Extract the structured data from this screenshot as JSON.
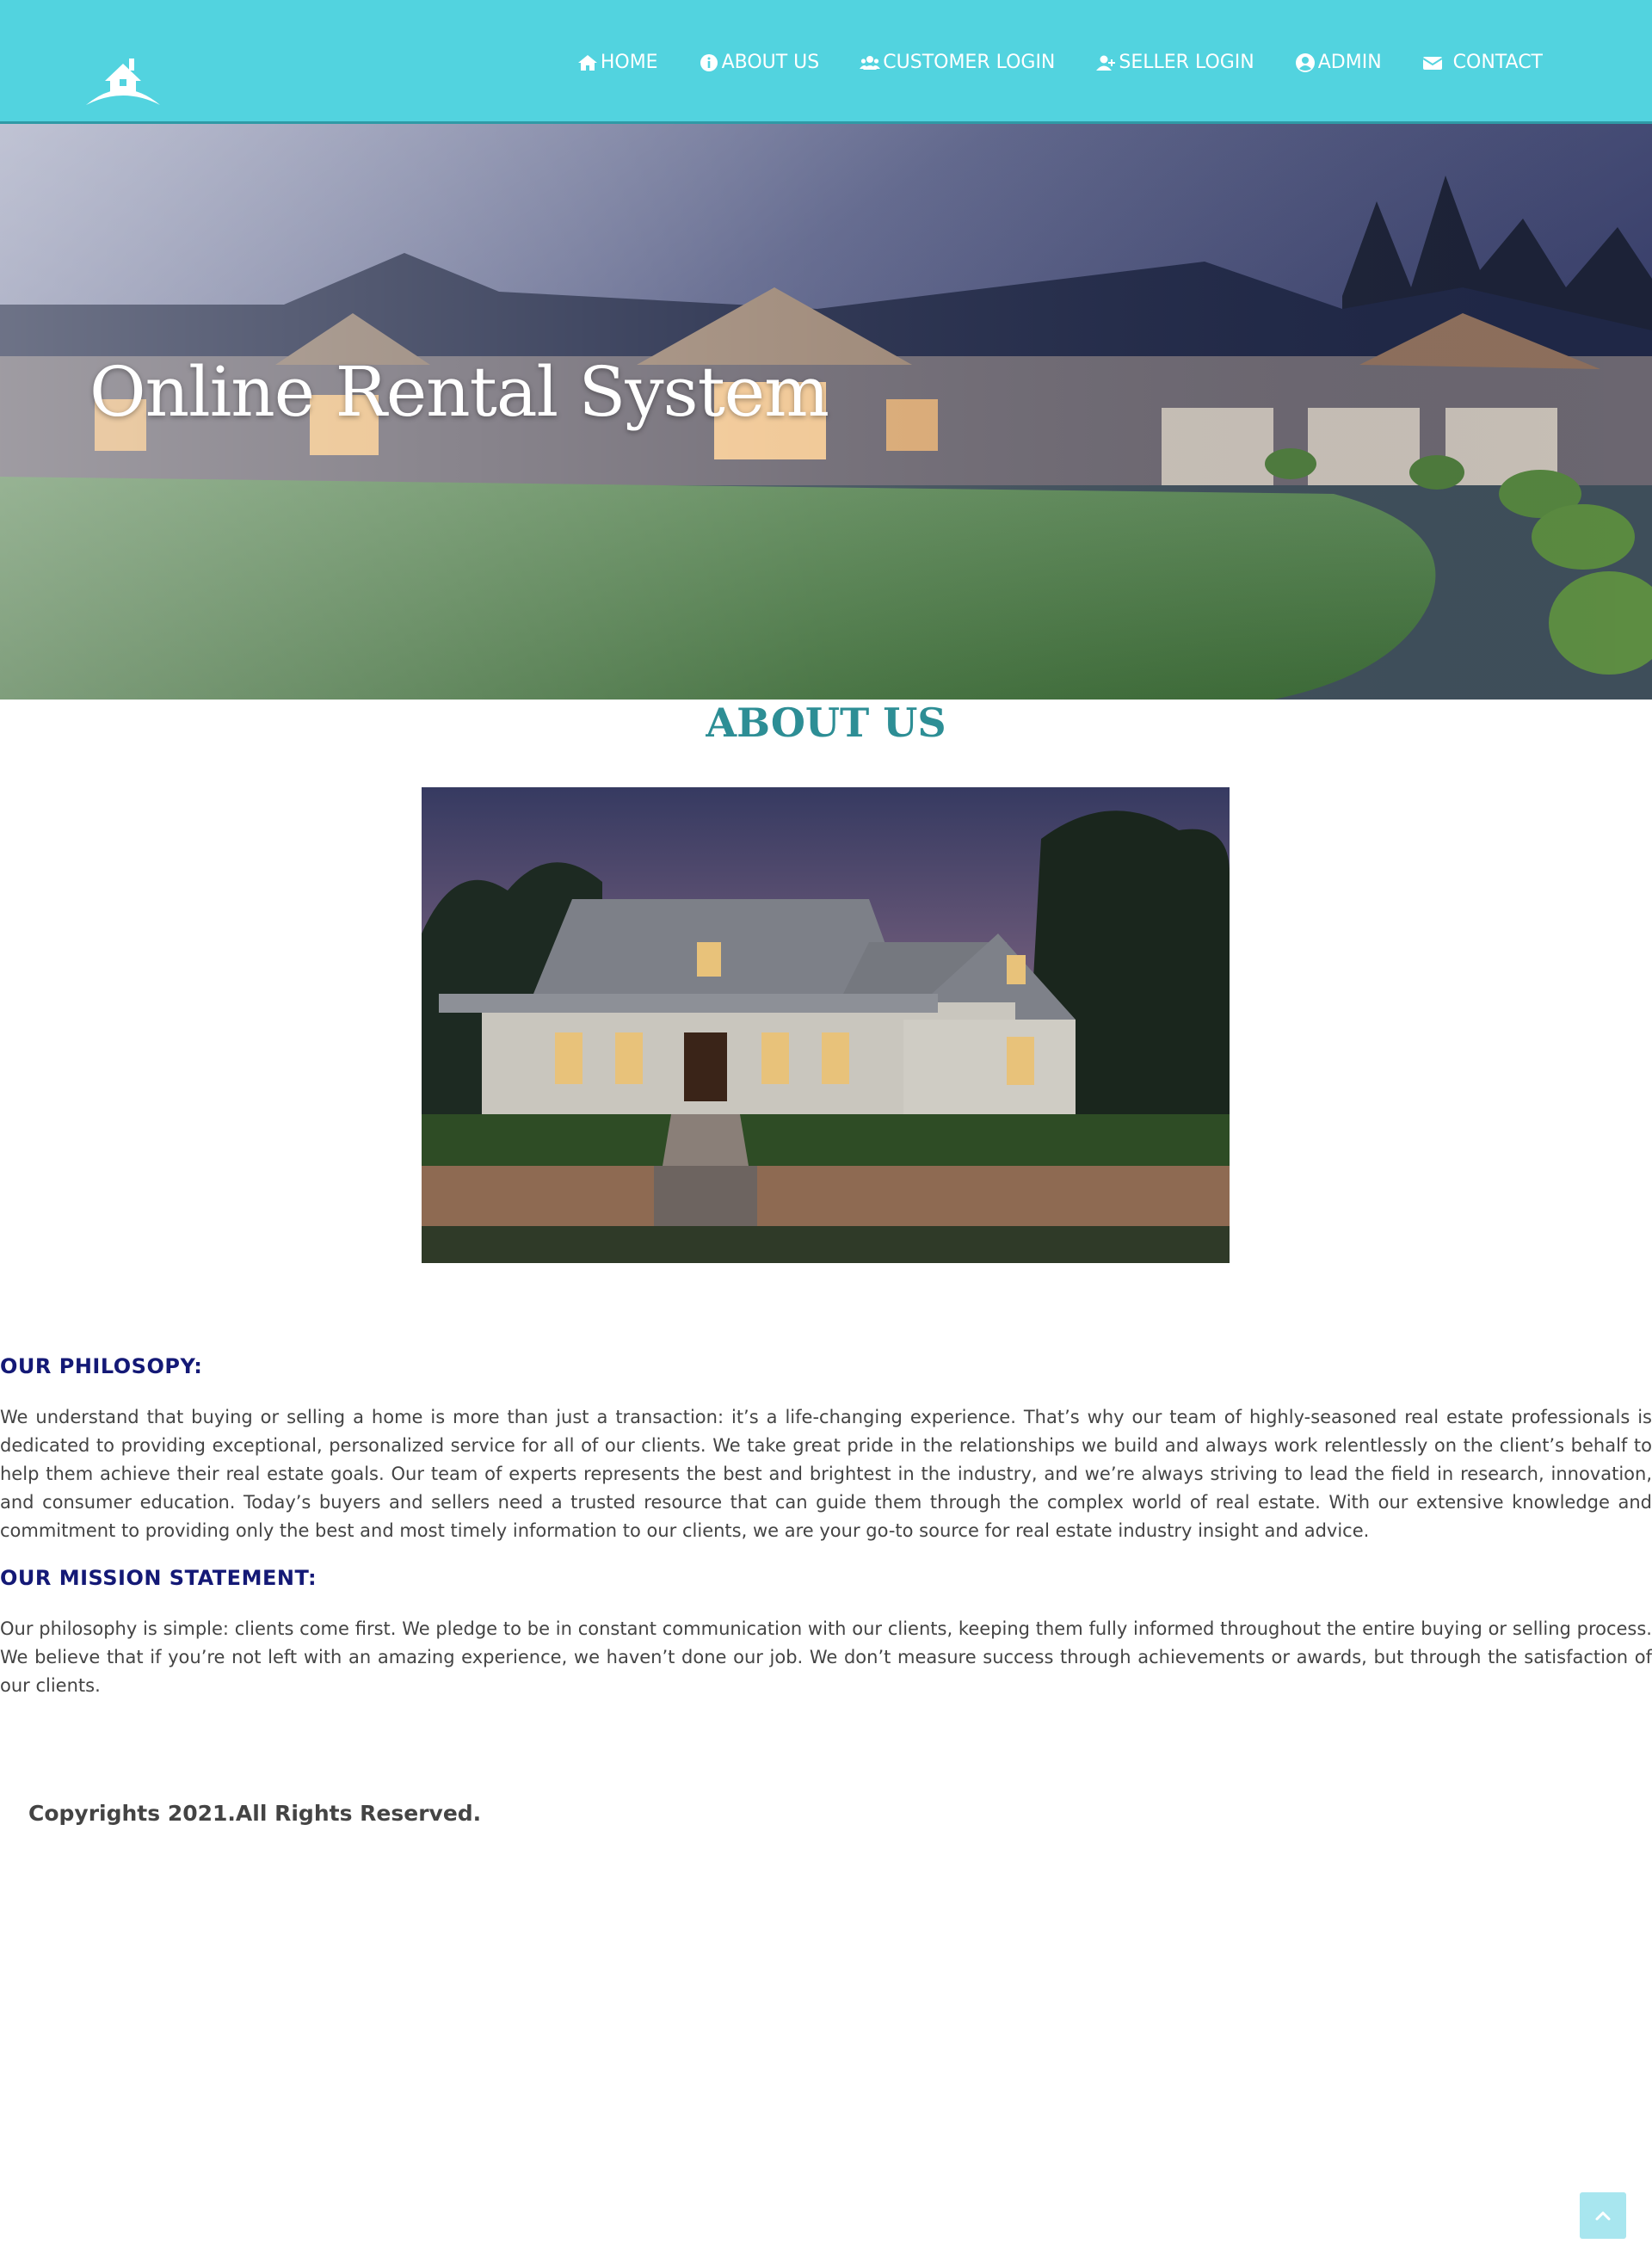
{
  "header": {
    "logo_icon": "house-roof-logo",
    "nav": [
      {
        "label": "HOME",
        "icon": "home-icon"
      },
      {
        "label": "ABOUT US",
        "icon": "info-circle-icon"
      },
      {
        "label": "CUSTOMER LOGIN",
        "icon": "users-icon"
      },
      {
        "label": "SELLER LOGIN",
        "icon": "user-plus-icon"
      },
      {
        "label": "ADMIN",
        "icon": "user-circle-icon"
      },
      {
        "label": "CONTACT",
        "icon": "envelope-icon"
      }
    ]
  },
  "hero": {
    "title": "Online Rental System"
  },
  "about": {
    "heading": "ABOUT US",
    "philosophy_heading": "OUR PHILOSOPY:",
    "philosophy_text": "We understand that buying or selling a home is more than just a transaction: it’s a life-changing experience. That’s why our team of highly-seasoned real estate professionals is dedicated to providing exceptional, personalized service for all of our clients. We take great pride in the relationships we build and always work relentlessly on the client’s behalf to help them achieve their real estate goals. Our team of experts represents the best and brightest in the industry, and we’re always striving to lead the field in research, innovation, and consumer education. Today’s buyers and sellers need a trusted resource that can guide them through the complex world of real estate. With our extensive knowledge and commitment to providing only the best and most timely information to our clients, we are your go-to source for real estate industry insight and advice.",
    "mission_heading": "OUR MISSION STATEMENT:",
    "mission_text": "Our philosophy is simple: clients come first. We pledge to be in constant communication with our clients, keeping them fully informed throughout the entire buying or selling process. We believe that if you’re not left with an amazing experience, we haven’t done our job. We don’t measure success through achievements or awards, but through the satisfaction of our clients."
  },
  "footer": {
    "copyright": "Copyrights 2021.All Rights Reserved."
  },
  "colors": {
    "header_bg": "#52d3df",
    "about_heading": "#2d8e95",
    "section_heading": "#141976",
    "back_to_top_bg": "#a8e6ef"
  },
  "back_to_top_icon": "chevron-up-icon"
}
